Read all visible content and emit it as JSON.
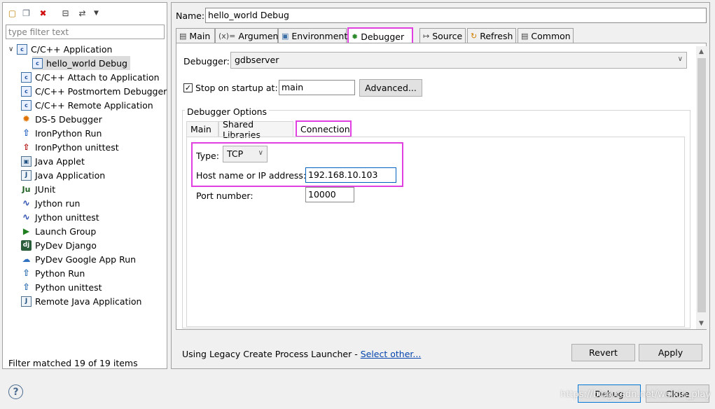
{
  "left": {
    "filter_placeholder": "type filter text",
    "tree": [
      {
        "label": "C/C++ Application",
        "icon": "c-app-icon"
      },
      {
        "label": "hello_world Debug",
        "icon": "c-app-icon"
      },
      {
        "label": "C/C++ Attach to Application",
        "icon": "c-app-icon"
      },
      {
        "label": "C/C++ Postmortem Debugger",
        "icon": "c-app-icon"
      },
      {
        "label": "C/C++ Remote Application",
        "icon": "c-app-icon"
      },
      {
        "label": "DS-5 Debugger",
        "icon": "ds5-icon"
      },
      {
        "label": "IronPython Run",
        "icon": "ironpython-icon"
      },
      {
        "label": "IronPython unittest",
        "icon": "ironpython-unittest-icon"
      },
      {
        "label": "Java Applet",
        "icon": "java-applet-icon"
      },
      {
        "label": "Java Application",
        "icon": "java-app-icon"
      },
      {
        "label": "JUnit",
        "icon": "junit-icon"
      },
      {
        "label": "Jython run",
        "icon": "jython-icon"
      },
      {
        "label": "Jython unittest",
        "icon": "jython-unittest-icon"
      },
      {
        "label": "Launch Group",
        "icon": "launch-group-icon"
      },
      {
        "label": "PyDev Django",
        "icon": "django-icon"
      },
      {
        "label": "PyDev Google App Run",
        "icon": "google-app-icon"
      },
      {
        "label": "Python Run",
        "icon": "python-icon"
      },
      {
        "label": "Python unittest",
        "icon": "python-unittest-icon"
      },
      {
        "label": "Remote Java Application",
        "icon": "remote-java-icon"
      }
    ],
    "status": "Filter matched 19 of 19 items"
  },
  "right": {
    "name_label": "Name:",
    "name_value": "hello_world Debug",
    "tabs": [
      {
        "label": "Main"
      },
      {
        "label": "Arguments"
      },
      {
        "label": "Environment"
      },
      {
        "label": "Debugger"
      },
      {
        "label": "Source"
      },
      {
        "label": "Refresh"
      },
      {
        "label": "Common"
      }
    ],
    "debugger_label": "Debugger:",
    "debugger_value": "gdbserver",
    "stop_label": "Stop on startup at:",
    "stop_value": "main",
    "advanced_label": "Advanced...",
    "options_legend": "Debugger Options",
    "subtabs": [
      {
        "label": "Main"
      },
      {
        "label": "Shared Libraries"
      },
      {
        "label": "Connection"
      }
    ],
    "type_label": "Type:",
    "type_value": "TCP",
    "host_label": "Host name or IP address:",
    "host_value": "192.168.10.103",
    "port_label": "Port number:",
    "port_value": "10000",
    "launcher_text": "Using Legacy Create Process Launcher - ",
    "select_other": "Select other...",
    "revert_label": "Revert",
    "apply_label": "Apply"
  },
  "bottom": {
    "debug_label": "Debug",
    "close_label": "Close",
    "watermark": "https://blog.csdn.net/weixin_play"
  },
  "colors": {
    "highlight": "#e040e0",
    "link": "#0645ad",
    "selection": "#dcdcdc"
  }
}
